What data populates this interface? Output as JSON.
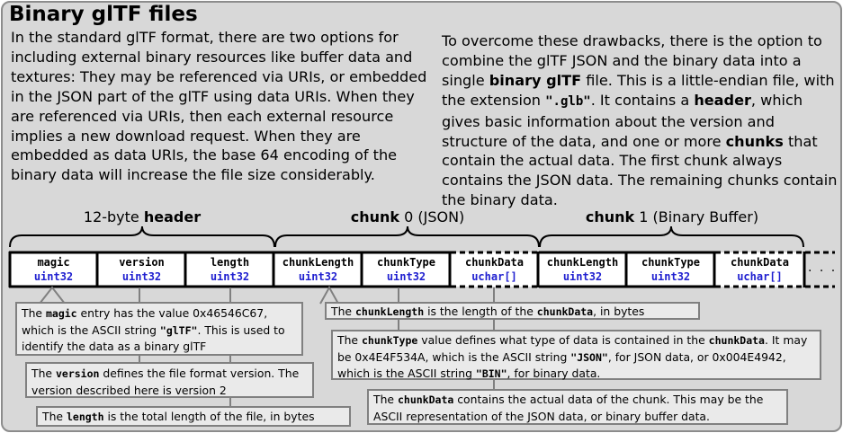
{
  "title": "Binary glTF files",
  "left_paragraph": [
    {
      "t": "In the standard glTF format, there are two options for including external binary resources like buffer data and textures: They may be referenced via URIs, or embedded in the JSON part of the glTF using data URIs. When they are referenced via URIs, then each external resource implies a new download request. When they are embedded as data URIs, the base 64 encoding of the binary data will increase the file size considerably.",
      "s": "n"
    }
  ],
  "right_paragraph": [
    {
      "t": "To overcome these drawbacks, there is the option to combine the glTF JSON and the binary data into a single ",
      "s": "n"
    },
    {
      "t": "binary glTF",
      "s": "b"
    },
    {
      "t": " file. This is a little-endian file, with the extension ",
      "s": "n"
    },
    {
      "t": "\".glb\"",
      "s": "m"
    },
    {
      "t": ". It contains a ",
      "s": "n"
    },
    {
      "t": "header",
      "s": "b"
    },
    {
      "t": ", which gives basic information about the version and structure of the data, and one or more ",
      "s": "n"
    },
    {
      "t": "chunks",
      "s": "b"
    },
    {
      "t": " that contain the actual data. The first chunk always contains the JSON data. The remaining chunks contain the binary data.",
      "s": "n"
    }
  ],
  "groups": {
    "header": {
      "prefix": "12-byte ",
      "bold": "header",
      "suffix": ""
    },
    "chunk0": {
      "prefix": "",
      "bold": "chunk",
      "suffix": " 0 (JSON)"
    },
    "chunk1": {
      "prefix": "",
      "bold": "chunk",
      "suffix": " 1 (Binary Buffer)"
    }
  },
  "fields": [
    {
      "name": "magic",
      "type": "uint32"
    },
    {
      "name": "version",
      "type": "uint32"
    },
    {
      "name": "length",
      "type": "uint32"
    },
    {
      "name": "chunkLength",
      "type": "uint32"
    },
    {
      "name": "chunkType",
      "type": "uint32"
    },
    {
      "name": "chunkData",
      "type": "uchar[]"
    },
    {
      "name": "chunkLength",
      "type": "uint32"
    },
    {
      "name": "chunkType",
      "type": "uint32"
    },
    {
      "name": "chunkData",
      "type": "uchar[]"
    }
  ],
  "ellipsis": ". . .",
  "callouts": {
    "magic": [
      {
        "t": "The ",
        "s": "n"
      },
      {
        "t": "magic",
        "s": "m"
      },
      {
        "t": " entry has the value 0x46546C67, which is the ASCII string ",
        "s": "n"
      },
      {
        "t": "\"glTF\"",
        "s": "m"
      },
      {
        "t": ". This is used to identify the data as a binary glTF",
        "s": "n"
      }
    ],
    "version": [
      {
        "t": "The ",
        "s": "n"
      },
      {
        "t": "version",
        "s": "m"
      },
      {
        "t": " defines the file format version. The version described here is version 2",
        "s": "n"
      }
    ],
    "length": [
      {
        "t": "The ",
        "s": "n"
      },
      {
        "t": "length",
        "s": "m"
      },
      {
        "t": " is the total length of the file, in bytes",
        "s": "n"
      }
    ],
    "chunkLength": [
      {
        "t": "The ",
        "s": "n"
      },
      {
        "t": "chunkLength",
        "s": "m"
      },
      {
        "t": " is the length of the ",
        "s": "n"
      },
      {
        "t": "chunkData",
        "s": "m"
      },
      {
        "t": ", in bytes",
        "s": "n"
      }
    ],
    "chunkType": [
      {
        "t": "The ",
        "s": "n"
      },
      {
        "t": "chunkType",
        "s": "m"
      },
      {
        "t": " value defines what type of data is contained in the ",
        "s": "n"
      },
      {
        "t": "chunkData",
        "s": "m"
      },
      {
        "t": ". It may be 0x4E4F534A, which is the ASCII string ",
        "s": "n"
      },
      {
        "t": "\"JSON\"",
        "s": "m"
      },
      {
        "t": ", for JSON data, or 0x004E4942, which is the ASCII string ",
        "s": "n"
      },
      {
        "t": "\"BIN\"",
        "s": "m"
      },
      {
        "t": ", for binary data.",
        "s": "n"
      }
    ],
    "chunkData": [
      {
        "t": "The ",
        "s": "n"
      },
      {
        "t": "chunkData",
        "s": "m"
      },
      {
        "t": " contains the actual data of the chunk. This may be the ASCII representation of the JSON data, or binary buffer data.",
        "s": "n"
      }
    ]
  }
}
